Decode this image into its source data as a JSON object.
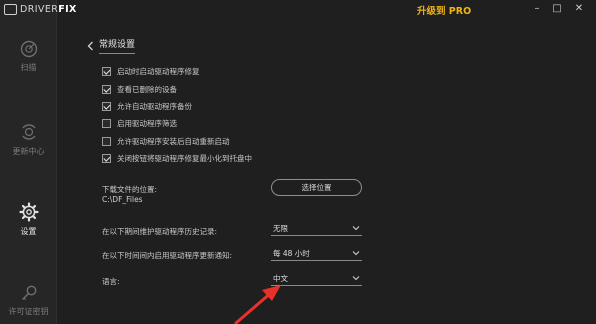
{
  "app": {
    "logo_text_a": "DRIVER",
    "logo_text_b": "FIX",
    "upgrade_label": "升级到 PRO",
    "window": {
      "minimize": "–",
      "maximize": "□",
      "close": "✕"
    }
  },
  "sidebar": {
    "items": [
      {
        "label": "扫描",
        "icon": "scan-icon"
      },
      {
        "label": "更新中心",
        "icon": "update-icon"
      },
      {
        "label": "设置",
        "icon": "gear-icon",
        "active": true
      },
      {
        "label": "许可证密钥",
        "icon": "key-icon"
      }
    ]
  },
  "header": {
    "title": "常规设置"
  },
  "options": [
    {
      "label": "启动时启动驱动程序修复",
      "checked": true
    },
    {
      "label": "查看已删除的设备",
      "checked": true
    },
    {
      "label": "允许自动驱动程序备份",
      "checked": true
    },
    {
      "label": "启用驱动程序筛选",
      "checked": false
    },
    {
      "label": "允许驱动程序安装后自动重新启动",
      "checked": false
    },
    {
      "label": "关闭按钮将驱动程序修复最小化到托盘中",
      "checked": true
    }
  ],
  "download": {
    "label": "下载文件的位置:",
    "path": "C:\\DF_Files",
    "browse_label": "选择位置"
  },
  "history": {
    "label": "在以下期间维护驱动程序历史记录:",
    "value": "无限"
  },
  "notify": {
    "label": "在以下时间间内启用驱动程序更新通知:",
    "value": "每 48 小时"
  },
  "language": {
    "label": "语言:",
    "value": "中文"
  },
  "colors": {
    "accent": "#f0b414",
    "arrow": "#e8312a"
  }
}
